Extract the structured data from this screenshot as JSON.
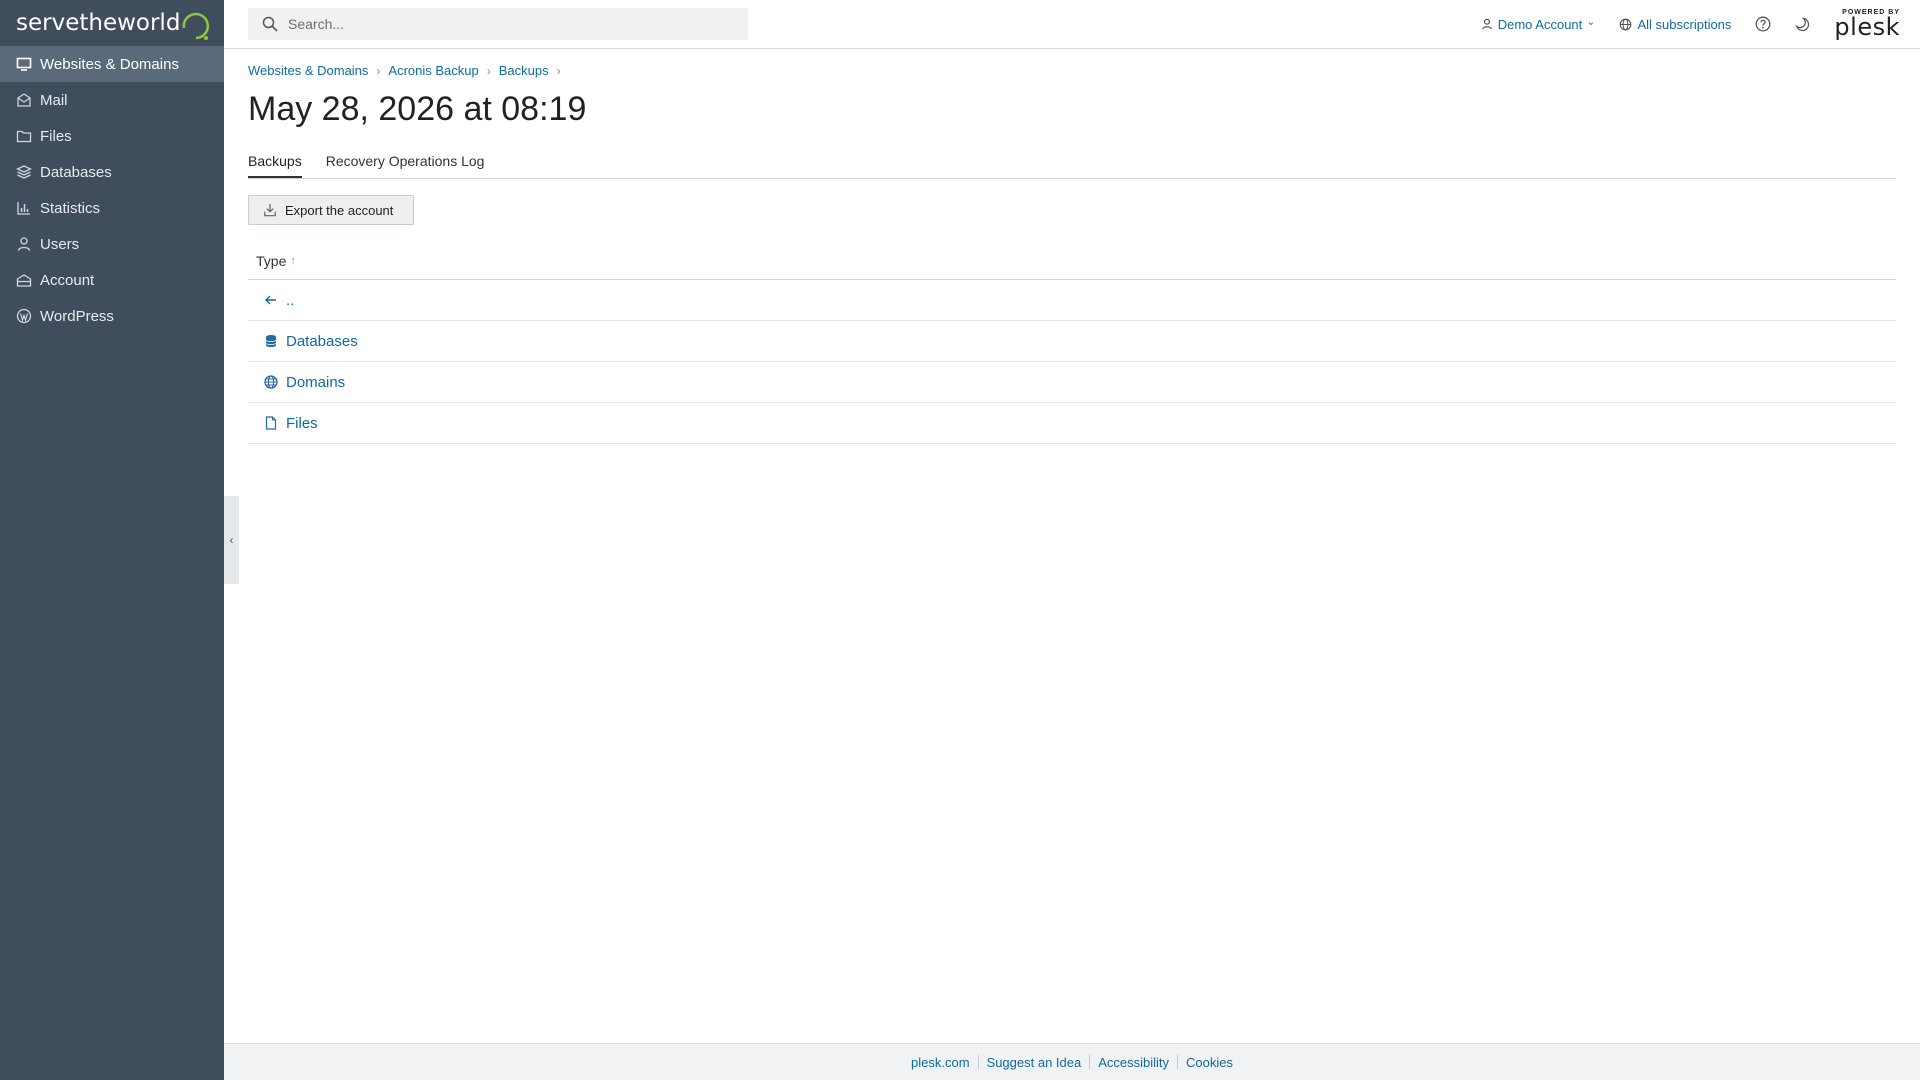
{
  "brand": {
    "logo_text": "servetheworld",
    "accent": "#8dc63f",
    "sidebar_bg": "#3f4d5c",
    "link_color": "#0f6ba0"
  },
  "sidebar": {
    "items": [
      {
        "label": "Websites & Domains",
        "icon": "monitor-icon",
        "active": true
      },
      {
        "label": "Mail",
        "icon": "mail-icon"
      },
      {
        "label": "Files",
        "icon": "folder-icon"
      },
      {
        "label": "Databases",
        "icon": "database-icon"
      },
      {
        "label": "Statistics",
        "icon": "bar-chart-icon"
      },
      {
        "label": "Users",
        "icon": "user-icon"
      },
      {
        "label": "Account",
        "icon": "account-icon"
      },
      {
        "label": "WordPress",
        "icon": "wordpress-icon"
      }
    ],
    "collapse_glyph": "‹"
  },
  "topbar": {
    "search_placeholder": "Search...",
    "account_label": "Demo Account",
    "account_chevron": "⌄",
    "subscriptions_label": "All subscriptions",
    "powered_by": "POWERED BY",
    "plesk": "plesk"
  },
  "breadcrumb": [
    "Websites & Domains",
    "Acronis Backup",
    "Backups"
  ],
  "breadcrumb_sep": "›",
  "page": {
    "title": "May 28, 2026 at 08:19"
  },
  "tabs": [
    {
      "label": "Backups",
      "active": true
    },
    {
      "label": "Recovery Operations Log"
    }
  ],
  "toolbar": {
    "export_label": "Export the account"
  },
  "list": {
    "header": "Type",
    "sort_arrow": "↑",
    "rows": [
      {
        "label": "..",
        "icon": "arrow-left-icon"
      },
      {
        "label": "Databases",
        "icon": "database-icon"
      },
      {
        "label": "Domains",
        "icon": "globe-icon"
      },
      {
        "label": "Files",
        "icon": "file-icon"
      }
    ]
  },
  "footer": {
    "links": [
      "plesk.com",
      "Suggest an Idea",
      "Accessibility",
      "Cookies"
    ]
  }
}
